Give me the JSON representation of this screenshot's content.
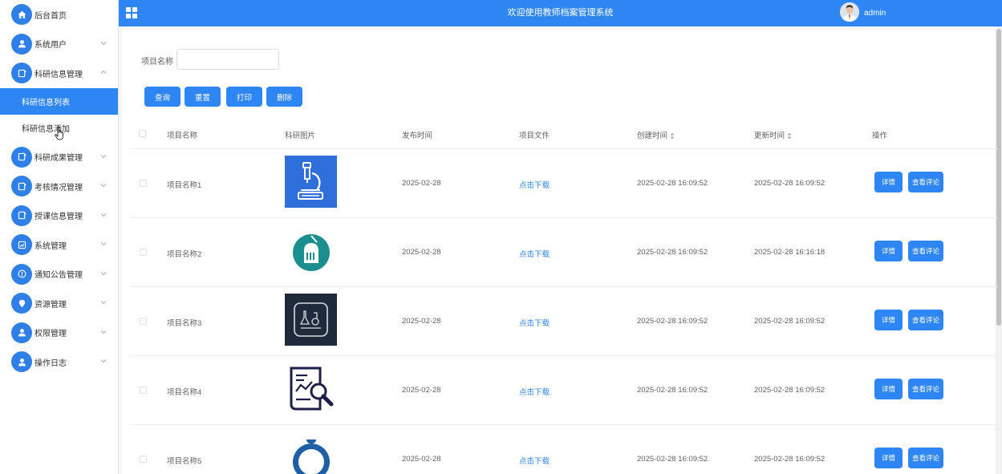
{
  "header": {
    "title": "欢迎使用教师档案管理系统",
    "user": "admin"
  },
  "sidebar": {
    "items": [
      {
        "label": "后台首页",
        "icon": "home-icon",
        "chevron": false
      },
      {
        "label": "系统用户",
        "icon": "user-icon",
        "chevron": true
      },
      {
        "label": "科研信息管理",
        "icon": "doc-icon",
        "chevron": true,
        "expanded": true
      }
    ],
    "sub_items": [
      {
        "label": "科研信息列表",
        "active": true
      },
      {
        "label": "科研信息添加",
        "active": false
      }
    ],
    "items_after": [
      {
        "label": "科研成果管理",
        "icon": "doc-icon"
      },
      {
        "label": "考核情况管理",
        "icon": "doc-icon"
      },
      {
        "label": "授课信息管理",
        "icon": "doc-icon"
      },
      {
        "label": "系统管理",
        "icon": "chart-icon"
      },
      {
        "label": "通知公告管理",
        "icon": "info-icon"
      },
      {
        "label": "资源管理",
        "icon": "location-icon"
      },
      {
        "label": "权限管理",
        "icon": "user-icon"
      },
      {
        "label": "操作日志",
        "icon": "user-icon"
      }
    ]
  },
  "search": {
    "label": "项目名称",
    "value": "",
    "placeholder": ""
  },
  "toolbar": {
    "query": "查询",
    "reset": "重置",
    "print": "打印",
    "delete": "删除"
  },
  "table": {
    "headers": {
      "name": "项目名称",
      "image": "科研图片",
      "publish": "发布时间",
      "file": "项目文件",
      "created": "创建时间",
      "updated": "更新时间",
      "ops": "操作"
    },
    "rows": [
      {
        "name": "项目名称1",
        "publish": "2025-02-28",
        "file": "点击下载",
        "created": "2025-02-28 16:09:52",
        "updated": "2025-02-28 16:09:52",
        "image_icon": "microscope-icon"
      },
      {
        "name": "项目名称2",
        "publish": "2025-02-28",
        "file": "点击下载",
        "created": "2025-02-28 16:09:52",
        "updated": "2025-02-28 16:16:18",
        "image_icon": "lab-logo-icon"
      },
      {
        "name": "项目名称3",
        "publish": "2025-02-28",
        "file": "点击下载",
        "created": "2025-02-28 16:09:52",
        "updated": "2025-02-28 16:09:52",
        "image_icon": "lab-tools-icon"
      },
      {
        "name": "项目名称4",
        "publish": "2025-02-28",
        "file": "点击下载",
        "created": "2025-02-28 16:09:52",
        "updated": "2025-02-28 16:09:52",
        "image_icon": "report-search-icon"
      },
      {
        "name": "项目名称5",
        "publish": "2025-02-28",
        "file": "点击下载",
        "created": "2025-02-28 16:09:52",
        "updated": "2025-02-28 16:09:52",
        "image_icon": "keyan-logo-icon"
      }
    ],
    "row_actions": {
      "detail": "详情",
      "comments": "查看评论"
    }
  },
  "colors": {
    "primary": "#2e86f5",
    "sidebar_icon": "#2f7fe9"
  }
}
